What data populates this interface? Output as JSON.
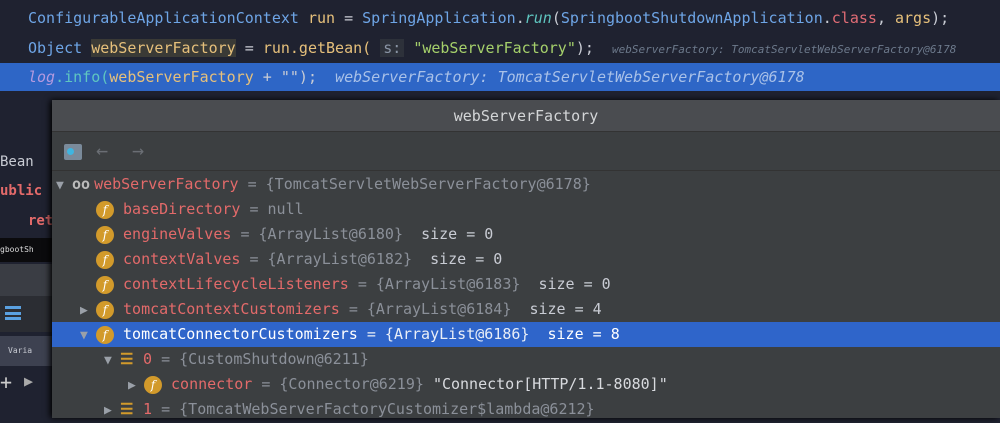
{
  "code": {
    "line1": {
      "type": "ConfigurableApplicationContext",
      "var": "run",
      "eq": " = ",
      "cls": "SpringApplication",
      "dot": ".",
      "method": "run",
      "arg_cls": "SpringbootShutdownApplication",
      "class_kw": "class",
      "args": "args",
      "end": ");"
    },
    "line2": {
      "type": "Object",
      "var": "webServerFactory",
      "call": "run.getBean(",
      "param_hint": "s:",
      "str": "\"webServerFactory\"",
      "end": ");",
      "hint": "webServerFactory: TomcatServletWebServerFactory@6178"
    },
    "line3": {
      "obj": "log",
      "method": ".info(",
      "var": "webServerFactory",
      "rest": " + \"\");",
      "hint": "webServerFactory: TomcatServletWebServerFactory@6178"
    }
  },
  "left": {
    "bean": "Bean",
    "public": "ublic",
    "ret": "ret",
    "tab": "gbootSh",
    "variables": "Varia",
    "add": "+"
  },
  "popup": {
    "title": "webServerFactory",
    "rows": [
      {
        "icon": "watch-icon",
        "name": "webServerFactory",
        "value": "= {TomcatServletWebServerFactory@6178}",
        "expanded": true
      },
      {
        "icon": "field-icon",
        "name": "baseDirectory",
        "value": "= null"
      },
      {
        "icon": "field-icon",
        "name": "engineValves",
        "value": "= {ArrayList@6180}",
        "size": "size = 0"
      },
      {
        "icon": "field-icon",
        "name": "contextValves",
        "value": "= {ArrayList@6182}",
        "size": "size = 0"
      },
      {
        "icon": "field-icon",
        "name": "contextLifecycleListeners",
        "value": "= {ArrayList@6183}",
        "size": "size = 0"
      },
      {
        "icon": "field-icon",
        "name": "tomcatContextCustomizers",
        "value": "= {ArrayList@6184}",
        "size": "size = 4"
      },
      {
        "icon": "field-icon",
        "name": "tomcatConnectorCustomizers",
        "value": "= {ArrayList@6186}",
        "size": "size = 8",
        "selected": true
      },
      {
        "icon": "list-icon",
        "name": "0",
        "value": "= {CustomShutdown@6211}"
      },
      {
        "icon": "field-icon",
        "name": "connector",
        "value": "= {Connector@6219}",
        "str": "\"Connector[HTTP/1.1-8080]\""
      },
      {
        "icon": "list-icon",
        "name": "1",
        "value": "= {TomcatWebServerFactoryCustomizer$lambda@6212}"
      }
    ]
  },
  "colors": {
    "selection": "#2f65ca",
    "editor_bg": "#1f2230"
  }
}
